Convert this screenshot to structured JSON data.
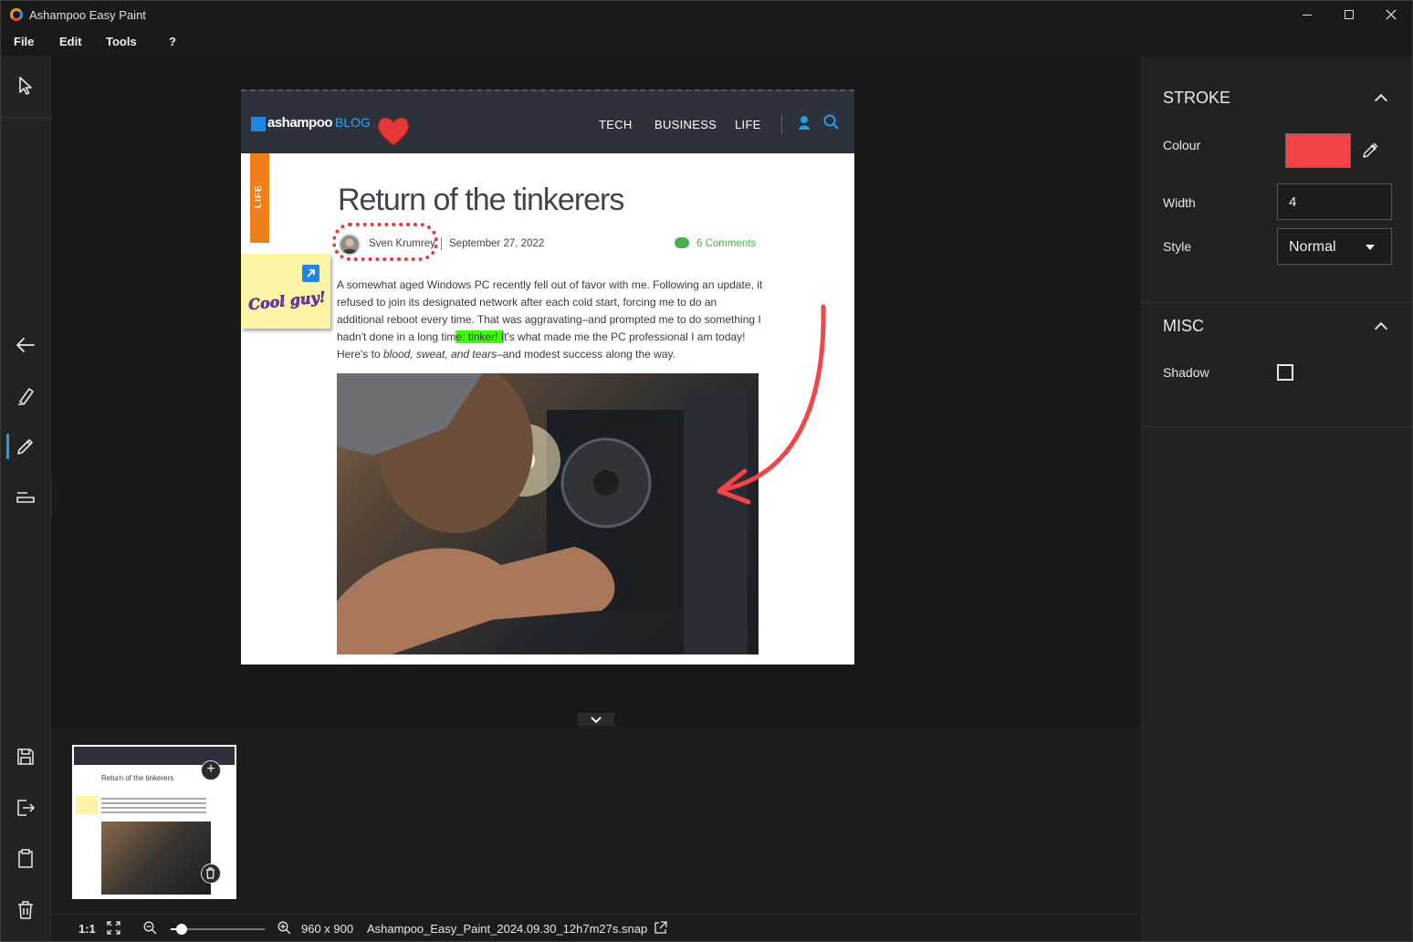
{
  "app": {
    "title": "Ashampoo Easy Paint"
  },
  "menu": [
    "File",
    "Edit",
    "Tools",
    "?"
  ],
  "document": {
    "brand": "ashampoo",
    "blog_label": "BLOG",
    "nav": [
      "TECH",
      "BUSINESS",
      "LIFE"
    ],
    "category_tag": "LIFE",
    "sticky_note": "Cool guy!",
    "title": "Return of the tinkerers",
    "author": "Sven Krumrey",
    "date": "September 27, 2022",
    "comments": "6 Comments",
    "body": {
      "p1": "A somewhat aged Windows PC recently fell out of favor with me. Following an update, it refused to join its designated network after each cold start, forcing me to do an additional reboot every time. That was aggravating–and prompted me to do something I hadn't done in a long tim",
      "highlight": "e: tinker! I",
      "p2": "t's what made me the PC professional I am today! Here's to ",
      "italic": "blood, sweat, and tears",
      "p3": "–and modest success along the way."
    }
  },
  "panel": {
    "stroke": {
      "title": "STROKE",
      "colour_label": "Colour",
      "colour_value": "#f5434a",
      "width_label": "Width",
      "width_value": "4",
      "style_label": "Style",
      "style_value": "Normal"
    },
    "misc": {
      "title": "MISC",
      "shadow_label": "Shadow",
      "shadow_checked": false
    }
  },
  "thumbnail": {
    "title": "Return of the tinkerers"
  },
  "statusbar": {
    "zoom_ratio": "1:1",
    "dimensions": "960 x 900",
    "filename": "Ashampoo_Easy_Paint_2024.09.30_12h7m27s.snap"
  }
}
